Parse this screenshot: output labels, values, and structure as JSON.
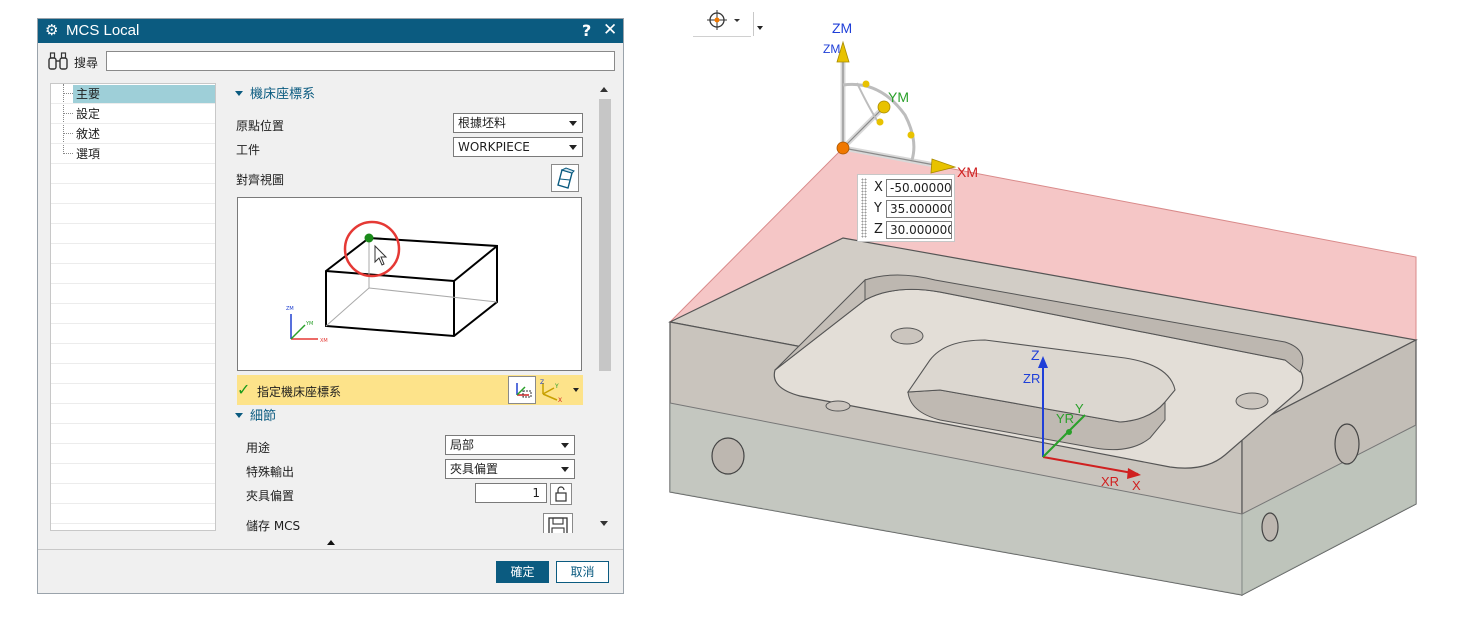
{
  "dialog": {
    "title": "MCS Local",
    "help_label": "?",
    "close_label": "✕",
    "search": {
      "label": "搜尋",
      "value": ""
    },
    "tree": {
      "items": [
        "主要",
        "設定",
        "敘述",
        "選項"
      ],
      "selected": "主要"
    },
    "main": {
      "section_title": "機床座標系",
      "origin_label": "原點位置",
      "origin_value": "根據坯料",
      "workpiece_label": "工件",
      "workpiece_value": "WORKPIECE",
      "align_view_label": "對齊視圖",
      "specify_label": "指定機床座標系",
      "preview_axes": {
        "z": "ZM",
        "y": "YM",
        "x": "XM"
      }
    },
    "details": {
      "section_title": "細節",
      "purpose_label": "用途",
      "purpose_value": "局部",
      "special_output_label": "特殊輸出",
      "special_output_value": "夾具偏置",
      "fixture_offset_label": "夾具偏置",
      "fixture_offset_value": "1",
      "save_mcs_label": "儲存 MCS"
    },
    "buttons": {
      "ok": "確定",
      "cancel": "取消"
    }
  },
  "graphics": {
    "coords": [
      {
        "axis": "X",
        "value": "-50.00000"
      },
      {
        "axis": "Y",
        "value": "35.000000"
      },
      {
        "axis": "Z",
        "value": "30.000000"
      }
    ],
    "mcs_labels": {
      "z": "ZM",
      "z_small": "ZM",
      "y": "YM",
      "x": "XM"
    },
    "wcs_labels": {
      "z": "Z",
      "zr": "ZR",
      "y": "Y",
      "yr": "YR",
      "x": "X",
      "xr": "XR"
    }
  },
  "colors": {
    "title_bar": "#0b5b80",
    "tree_selected": "#9ecfd8",
    "specify_bar": "#fde38a",
    "blank_fill": "#f3c6c6",
    "part_fill": "#cfc9c2",
    "axis_x": "#d02020",
    "axis_y": "#2aa02a",
    "axis_z": "#1f3fd8",
    "mcs_handle": "#e8c200",
    "origin": "#f07800"
  }
}
